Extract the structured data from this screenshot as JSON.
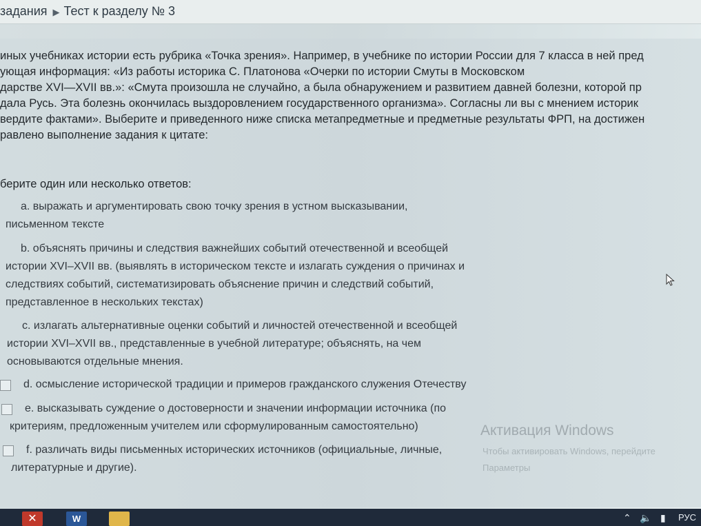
{
  "breadcrumb": {
    "items": [
      "задания",
      "Тест к разделу № 3"
    ],
    "separator_icon": "triangle-right-icon"
  },
  "question": {
    "lines": [
      "иных учебниках истории есть рубрика «Точка зрения». Например, в учебнике по истории России для 7 класса в ней пред",
      "ующая информация: «Из работы историка С. Платонова «Очерки по истории Смуты в Московском",
      "дарстве XVI—XVII вв.»: «Смута произошла не случайно, а была обнаружением и развитием давней болезни, которой пр",
      "дала Русь. Эта болезнь окончилась выздоровлением государственного организма». Согласны ли вы с мнением историк",
      "вердите фактами». Выберите и приведенного ниже списка метапредметные и предметные результаты ФРП, на достижен",
      "равлено выполнение задания к цитате:"
    ]
  },
  "prompt": "берите один или несколько ответов:",
  "options": [
    {
      "lines": [
        "a. выражать и аргументировать свою точку зрения в устном высказывании,",
        "письменном тексте"
      ],
      "checked": false
    },
    {
      "lines": [
        "b. объяснять причины и следствия важнейших событий отечественной и всеобщей",
        "истории XVI–XVII вв. (выявлять в историческом тексте и излагать суждения о причинах и",
        "следствиях событий, систематизировать объяснение причин и следствий событий,",
        "представленное в нескольких текстах)"
      ],
      "checked": false
    },
    {
      "lines": [
        "c. излагать альтернативные оценки событий и личностей отечественной и всеобщей",
        "истории XVI–XVII вв., представленные в учебной литературе; объяснять, на чем",
        "основываются отдельные мнения."
      ],
      "checked": false
    },
    {
      "lines": [
        "d. осмысление исторической традиции и примеров гражданского служения Отечеству"
      ],
      "checked": false
    },
    {
      "lines": [
        "e. высказывать суждение о достоверности и значении информации источника (по",
        "критериям, предложенным учителем или сформулированным самостоятельно)"
      ],
      "checked": false
    },
    {
      "lines": [
        "f. различать виды письменных исторических источников (официальные, личные,",
        "литературные и другие)."
      ],
      "checked": false
    }
  ],
  "watermark": {
    "title": "Активация Windows",
    "line1": "Чтобы активировать Windows, перейдите",
    "line2": "Параметры"
  },
  "taskbar": {
    "word_label": "W",
    "language": "РУС",
    "icons": [
      "close-app-icon",
      "word-icon",
      "folder-icon",
      "chevron-up-icon",
      "speaker-icon",
      "battery-icon"
    ]
  },
  "colors": {
    "background": "#cfd9dc",
    "text": "#24292d",
    "taskbar": "#1f2a3a"
  }
}
